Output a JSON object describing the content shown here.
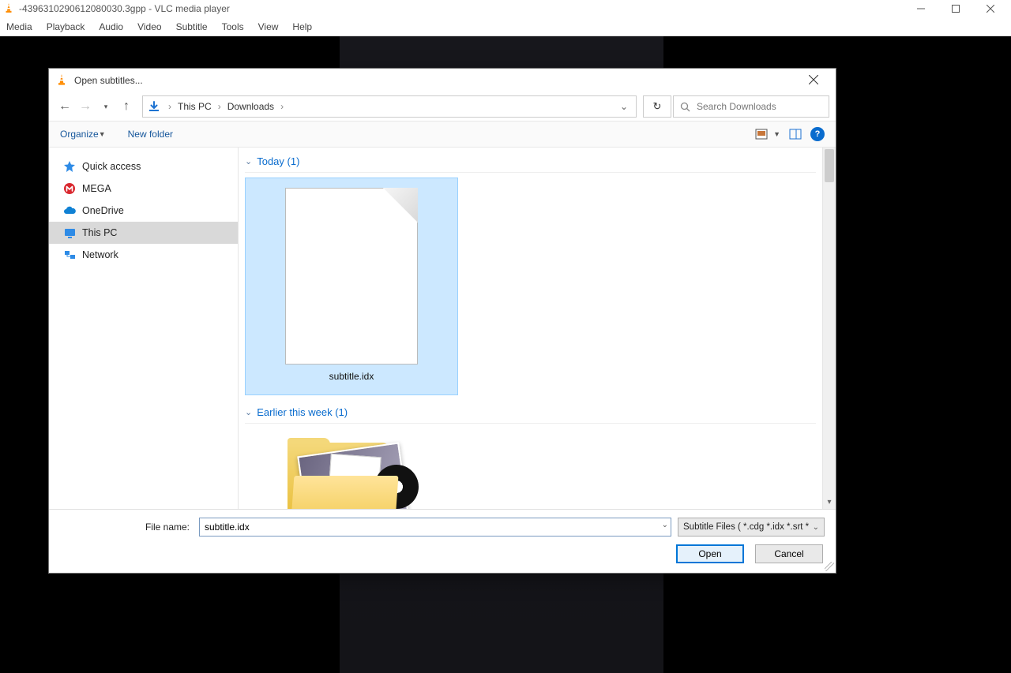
{
  "vlc": {
    "title": "-4396310290612080030.3gpp - VLC media player",
    "menus": [
      "Media",
      "Playback",
      "Audio",
      "Video",
      "Subtitle",
      "Tools",
      "View",
      "Help"
    ]
  },
  "dialog": {
    "title": "Open subtitles...",
    "breadcrumb": {
      "root": "This PC",
      "folder": "Downloads"
    },
    "search_placeholder": "Search Downloads",
    "toolbar": {
      "organize": "Organize",
      "new_folder": "New folder"
    },
    "tree": {
      "quick_access": "Quick access",
      "mega": "MEGA",
      "onedrive": "OneDrive",
      "this_pc": "This PC",
      "network": "Network"
    },
    "groups": {
      "today": "Today (1)",
      "earlier": "Earlier this week (1)"
    },
    "files": {
      "selected_name": "subtitle.idx"
    },
    "footer": {
      "filename_label": "File name:",
      "filename_value": "subtitle.idx",
      "filetype": "Subtitle Files ( *.cdg *.idx *.srt *",
      "open": "Open",
      "cancel": "Cancel"
    }
  }
}
